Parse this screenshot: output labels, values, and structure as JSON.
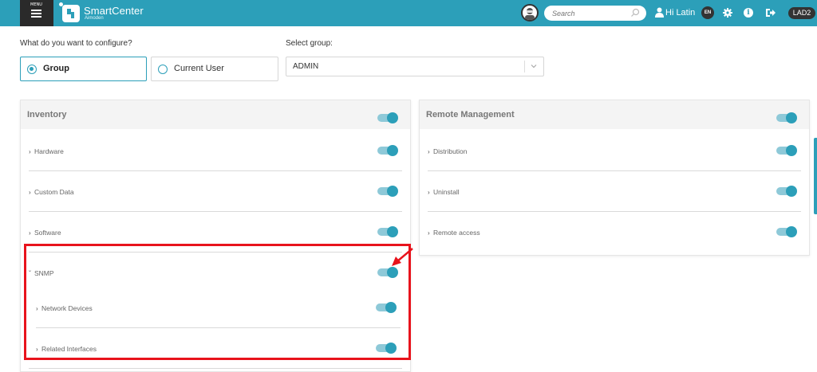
{
  "header": {
    "menu_tag": "MENU",
    "brand": "SmartCenter",
    "brand_sub": "Aimoden",
    "search_placeholder": "Search",
    "greeting": "Hi Latin",
    "language": "EN",
    "environment": "LAD2",
    "accent_color": "#2c9fb9"
  },
  "config": {
    "question": "What do you want to configure?",
    "options": [
      {
        "label": "Group",
        "selected": true
      },
      {
        "label": "Current User",
        "selected": false
      }
    ],
    "group_label": "Select group:",
    "group_value": "ADMIN"
  },
  "inventory": {
    "title": "Inventory",
    "enabled": true,
    "rows": [
      {
        "label": "Hardware",
        "enabled": true
      },
      {
        "label": "Custom Data",
        "enabled": true
      },
      {
        "label": "Software",
        "enabled": true
      },
      {
        "label": "SNMP",
        "enabled": true,
        "expanded": true
      },
      {
        "label": "Network Devices",
        "enabled": true
      },
      {
        "label": "Related Interfaces",
        "enabled": true
      }
    ]
  },
  "remote": {
    "title": "Remote Management",
    "enabled": true,
    "rows": [
      {
        "label": "Distribution",
        "enabled": true
      },
      {
        "label": "Uninstall",
        "enabled": true
      },
      {
        "label": "Remote access",
        "enabled": true
      }
    ]
  },
  "annotation_color": "#e8131c"
}
